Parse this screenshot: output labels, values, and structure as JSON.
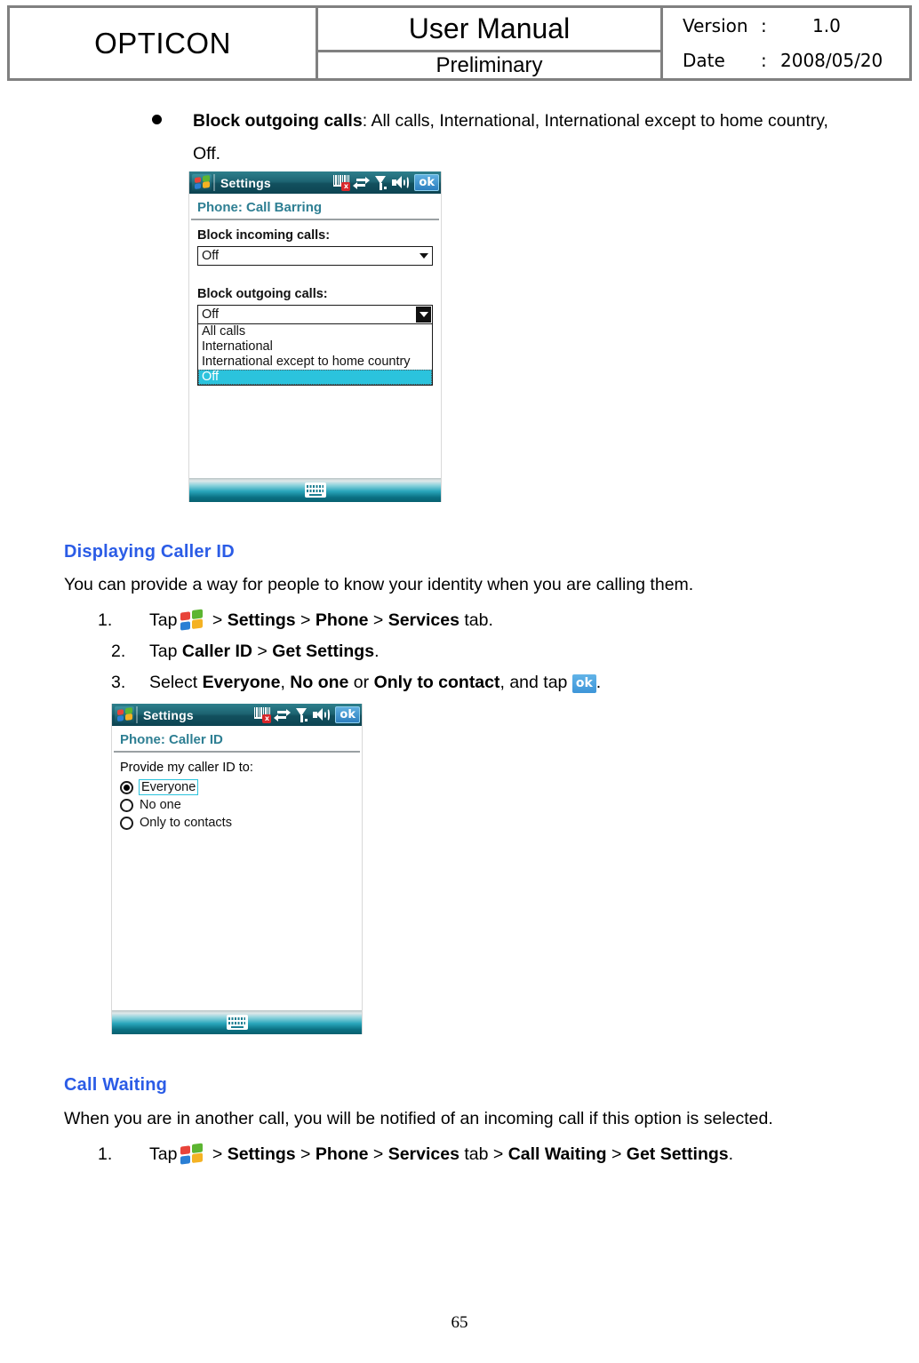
{
  "header": {
    "brand": "OPTICON",
    "doc_title": "User Manual",
    "doc_status": "Preliminary",
    "version_label": "Version",
    "version_colon": ":",
    "version_value": "1.0",
    "date_label": "Date",
    "date_colon": ":",
    "date_value": "2008/05/20"
  },
  "bullet": {
    "term": "Block outgoing calls",
    "rest": ": All calls, International, International except to home country, Off."
  },
  "screenshot1": {
    "app_title": "Settings",
    "page_header": "Phone: Call Barring",
    "ok_label": "ok",
    "incoming_label": "Block incoming calls:",
    "incoming_value": "Off",
    "outgoing_label": "Block outgoing calls:",
    "outgoing_value": "Off",
    "options": [
      "All calls",
      "International",
      "International except to home country",
      "Off"
    ],
    "selected_option": "Off",
    "tray_icons": [
      "barcode-disabled-icon",
      "connectivity-icon",
      "signal-icon",
      "speaker-icon",
      "ok-button"
    ],
    "sip_icon": "keyboard-icon"
  },
  "section_caller_id": {
    "heading": "Displaying Caller ID",
    "intro": "You can provide a way for people to know your identity when you are calling them.",
    "steps": [
      {
        "num": "1.",
        "pre": "Tap",
        "icon": "windows-start-icon",
        "parts": [
          {
            "t": " > ",
            "b": false
          },
          {
            "t": "Settings",
            "b": true
          },
          {
            "t": " > ",
            "b": false
          },
          {
            "t": "Phone",
            "b": true
          },
          {
            "t": " > ",
            "b": false
          },
          {
            "t": "Services",
            "b": true
          },
          {
            "t": " tab.",
            "b": false
          }
        ]
      },
      {
        "num": "2.",
        "pre": "Tap ",
        "icon": null,
        "parts": [
          {
            "t": "Caller ID",
            "b": true
          },
          {
            "t": " > ",
            "b": false
          },
          {
            "t": "Get Settings",
            "b": true
          },
          {
            "t": ".",
            "b": false
          }
        ]
      },
      {
        "num": "3.",
        "pre": "Select ",
        "icon": null,
        "parts": [
          {
            "t": "Everyone",
            "b": true
          },
          {
            "t": ", ",
            "b": false
          },
          {
            "t": "No one",
            "b": true
          },
          {
            "t": " or ",
            "b": false
          },
          {
            "t": "Only to contact",
            "b": true
          },
          {
            "t": ", and tap ",
            "b": false
          }
        ],
        "trailing_badge": "ok",
        "trailing_text": "."
      }
    ]
  },
  "screenshot2": {
    "app_title": "Settings",
    "page_header": "Phone: Caller ID",
    "ok_label": "ok",
    "prompt": "Provide my caller ID to:",
    "radios": [
      {
        "label": "Everyone",
        "selected": true,
        "focused": true
      },
      {
        "label": "No one",
        "selected": false,
        "focused": false
      },
      {
        "label": "Only to contacts",
        "selected": false,
        "focused": false
      }
    ],
    "sip_icon": "keyboard-icon"
  },
  "section_call_waiting": {
    "heading": "Call Waiting",
    "intro": "When you are in another call, you will be notified of an incoming call if this option is selected.",
    "step": {
      "num": "1.",
      "pre": "Tap",
      "icon": "windows-start-icon",
      "parts": [
        {
          "t": " > ",
          "b": false
        },
        {
          "t": "Settings",
          "b": true
        },
        {
          "t": " > ",
          "b": false
        },
        {
          "t": "Phone",
          "b": true
        },
        {
          "t": " > ",
          "b": false
        },
        {
          "t": "Services",
          "b": true
        },
        {
          "t": " tab > ",
          "b": false
        },
        {
          "t": "Call Waiting",
          "b": true
        },
        {
          "t": " > ",
          "b": false
        },
        {
          "t": "Get Settings",
          "b": true
        },
        {
          "t": ".",
          "b": false
        }
      ]
    }
  },
  "footer": {
    "page_number": "65"
  },
  "colors": {
    "heading_blue": "#2b5ce6",
    "pda_titlebar_teal": "#1d6472",
    "pda_pagehead_teal": "#2e7f93",
    "selection_cyan": "#2bc3dd",
    "header_border_gray": "#808080"
  }
}
